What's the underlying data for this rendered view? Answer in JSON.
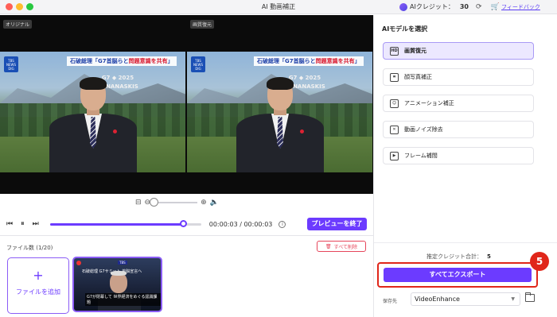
{
  "window": {
    "title": "AI 動画補正"
  },
  "header": {
    "credit_label": "AIクレジット：",
    "credit_value": "30",
    "feedback": "フィードバック"
  },
  "preview": {
    "left_label": "オリジナル",
    "right_label": "画質復元",
    "banner_prefix": "石破総理「G7首脳らと",
    "banner_highlight": "問題意識を共有",
    "banner_suffix": "」",
    "logo_text": "TBS NEWS DIG",
    "sign_text": "G7 ◆ 2025 KANANASKIS"
  },
  "player": {
    "current_time": "00:00:03",
    "separator": "/",
    "total_time": "00:00:03",
    "progress": 0.88,
    "zoom_level": 0.0,
    "end_preview_label": "プレビューを終了"
  },
  "files": {
    "count_label": "ファイル数 (1/20)",
    "delete_all_label": "すべて削除",
    "add_label": "ファイルを追加",
    "thumb_caption": "G7が閉幕して 世界経済をめぐる認識課題",
    "thumb_text": "石破総理 G7サミット 首脳宣言へ"
  },
  "panel": {
    "title": "AIモデルを選択",
    "models": [
      {
        "label": "画質復元",
        "icon": "hd-icon",
        "active": true
      },
      {
        "label": "顔写真補正",
        "icon": "face-scan-icon",
        "active": false
      },
      {
        "label": "アニメーション補正",
        "icon": "anime-icon",
        "active": false
      },
      {
        "label": "動画ノイズ除去",
        "icon": "denoise-icon",
        "active": false
      },
      {
        "label": "フレーム補間",
        "icon": "frame-icon",
        "active": false
      }
    ],
    "estimate_label": "推定クレジット合計：",
    "estimate_value": "5",
    "export_label": "すべてエクスポート",
    "step_badge": "5",
    "save_label": "保存先",
    "save_value": "VideoEnhance"
  },
  "colors": {
    "accent": "#6c3bff",
    "highlight": "#e0261a"
  }
}
